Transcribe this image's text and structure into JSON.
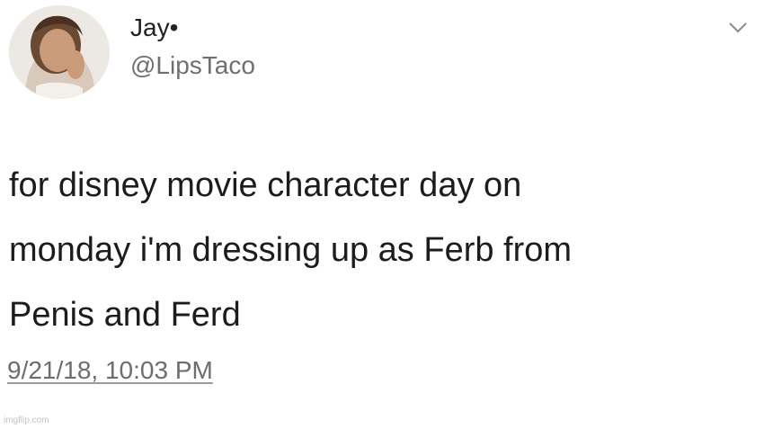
{
  "tweet": {
    "display_name": "Jay•",
    "handle": "@LipsTaco",
    "body_lines": [
      "for disney movie character day on",
      "monday i'm dressing up as Ferb from",
      "Penis and Ferd"
    ],
    "timestamp": "9/21/18, 10:03 PM",
    "avatar_icon": "user-avatar-photo",
    "menu_icon": "chevron-down-icon"
  },
  "watermark": "imgflip.com",
  "colors": {
    "background": "#ffffff",
    "text": "#1c1c1c",
    "secondary_text": "#6f6f6f"
  }
}
